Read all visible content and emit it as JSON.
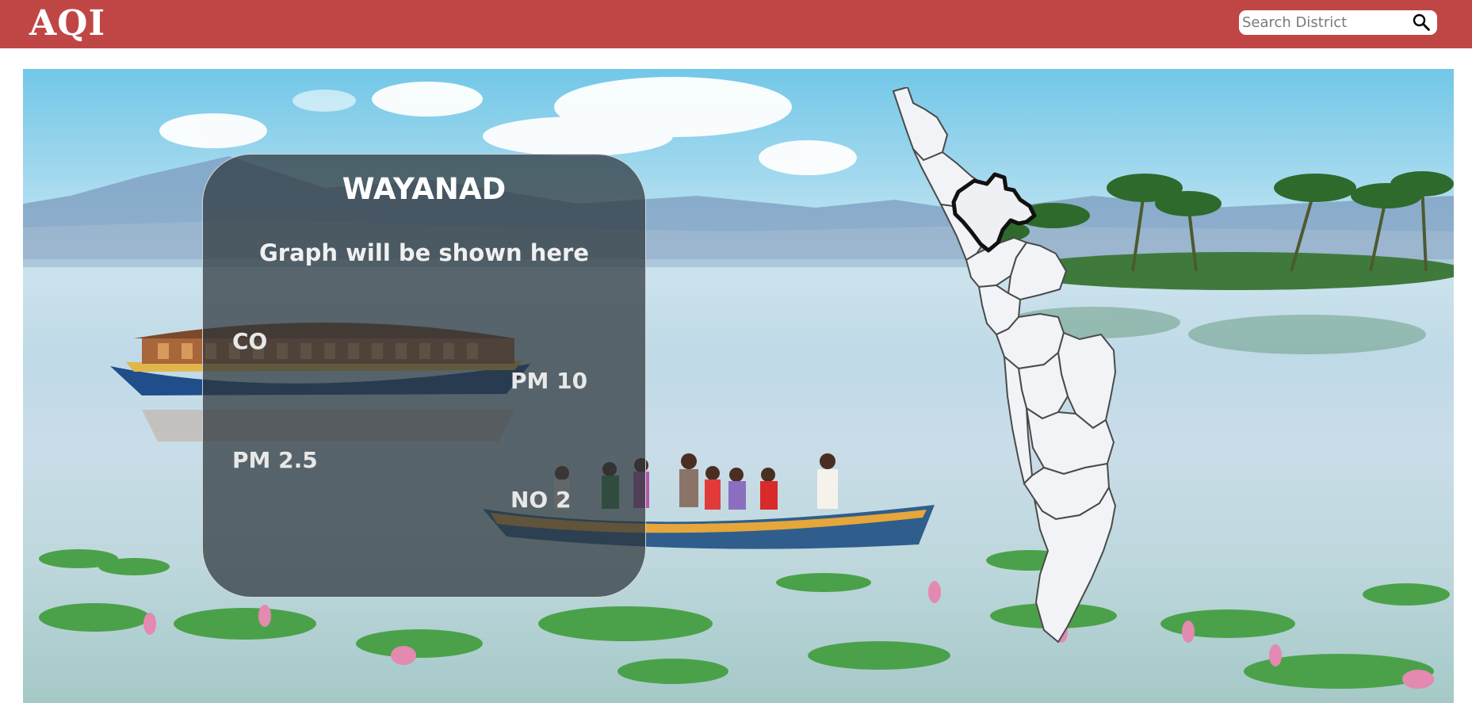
{
  "header": {
    "brand": "AQI",
    "search": {
      "placeholder": "Search District"
    }
  },
  "card": {
    "district": "WAYANAD",
    "graph_placeholder": "Graph will be shown here",
    "pollutants": [
      "CO",
      "PM 10",
      "PM 2.5",
      "NO 2"
    ]
  },
  "map": {
    "selected_district": "Wayanad"
  },
  "colors": {
    "header_bg": "#c04646",
    "card_bg": "#2d343a",
    "map_fill": "#f1f3f6",
    "selected_outline": "#111111"
  }
}
